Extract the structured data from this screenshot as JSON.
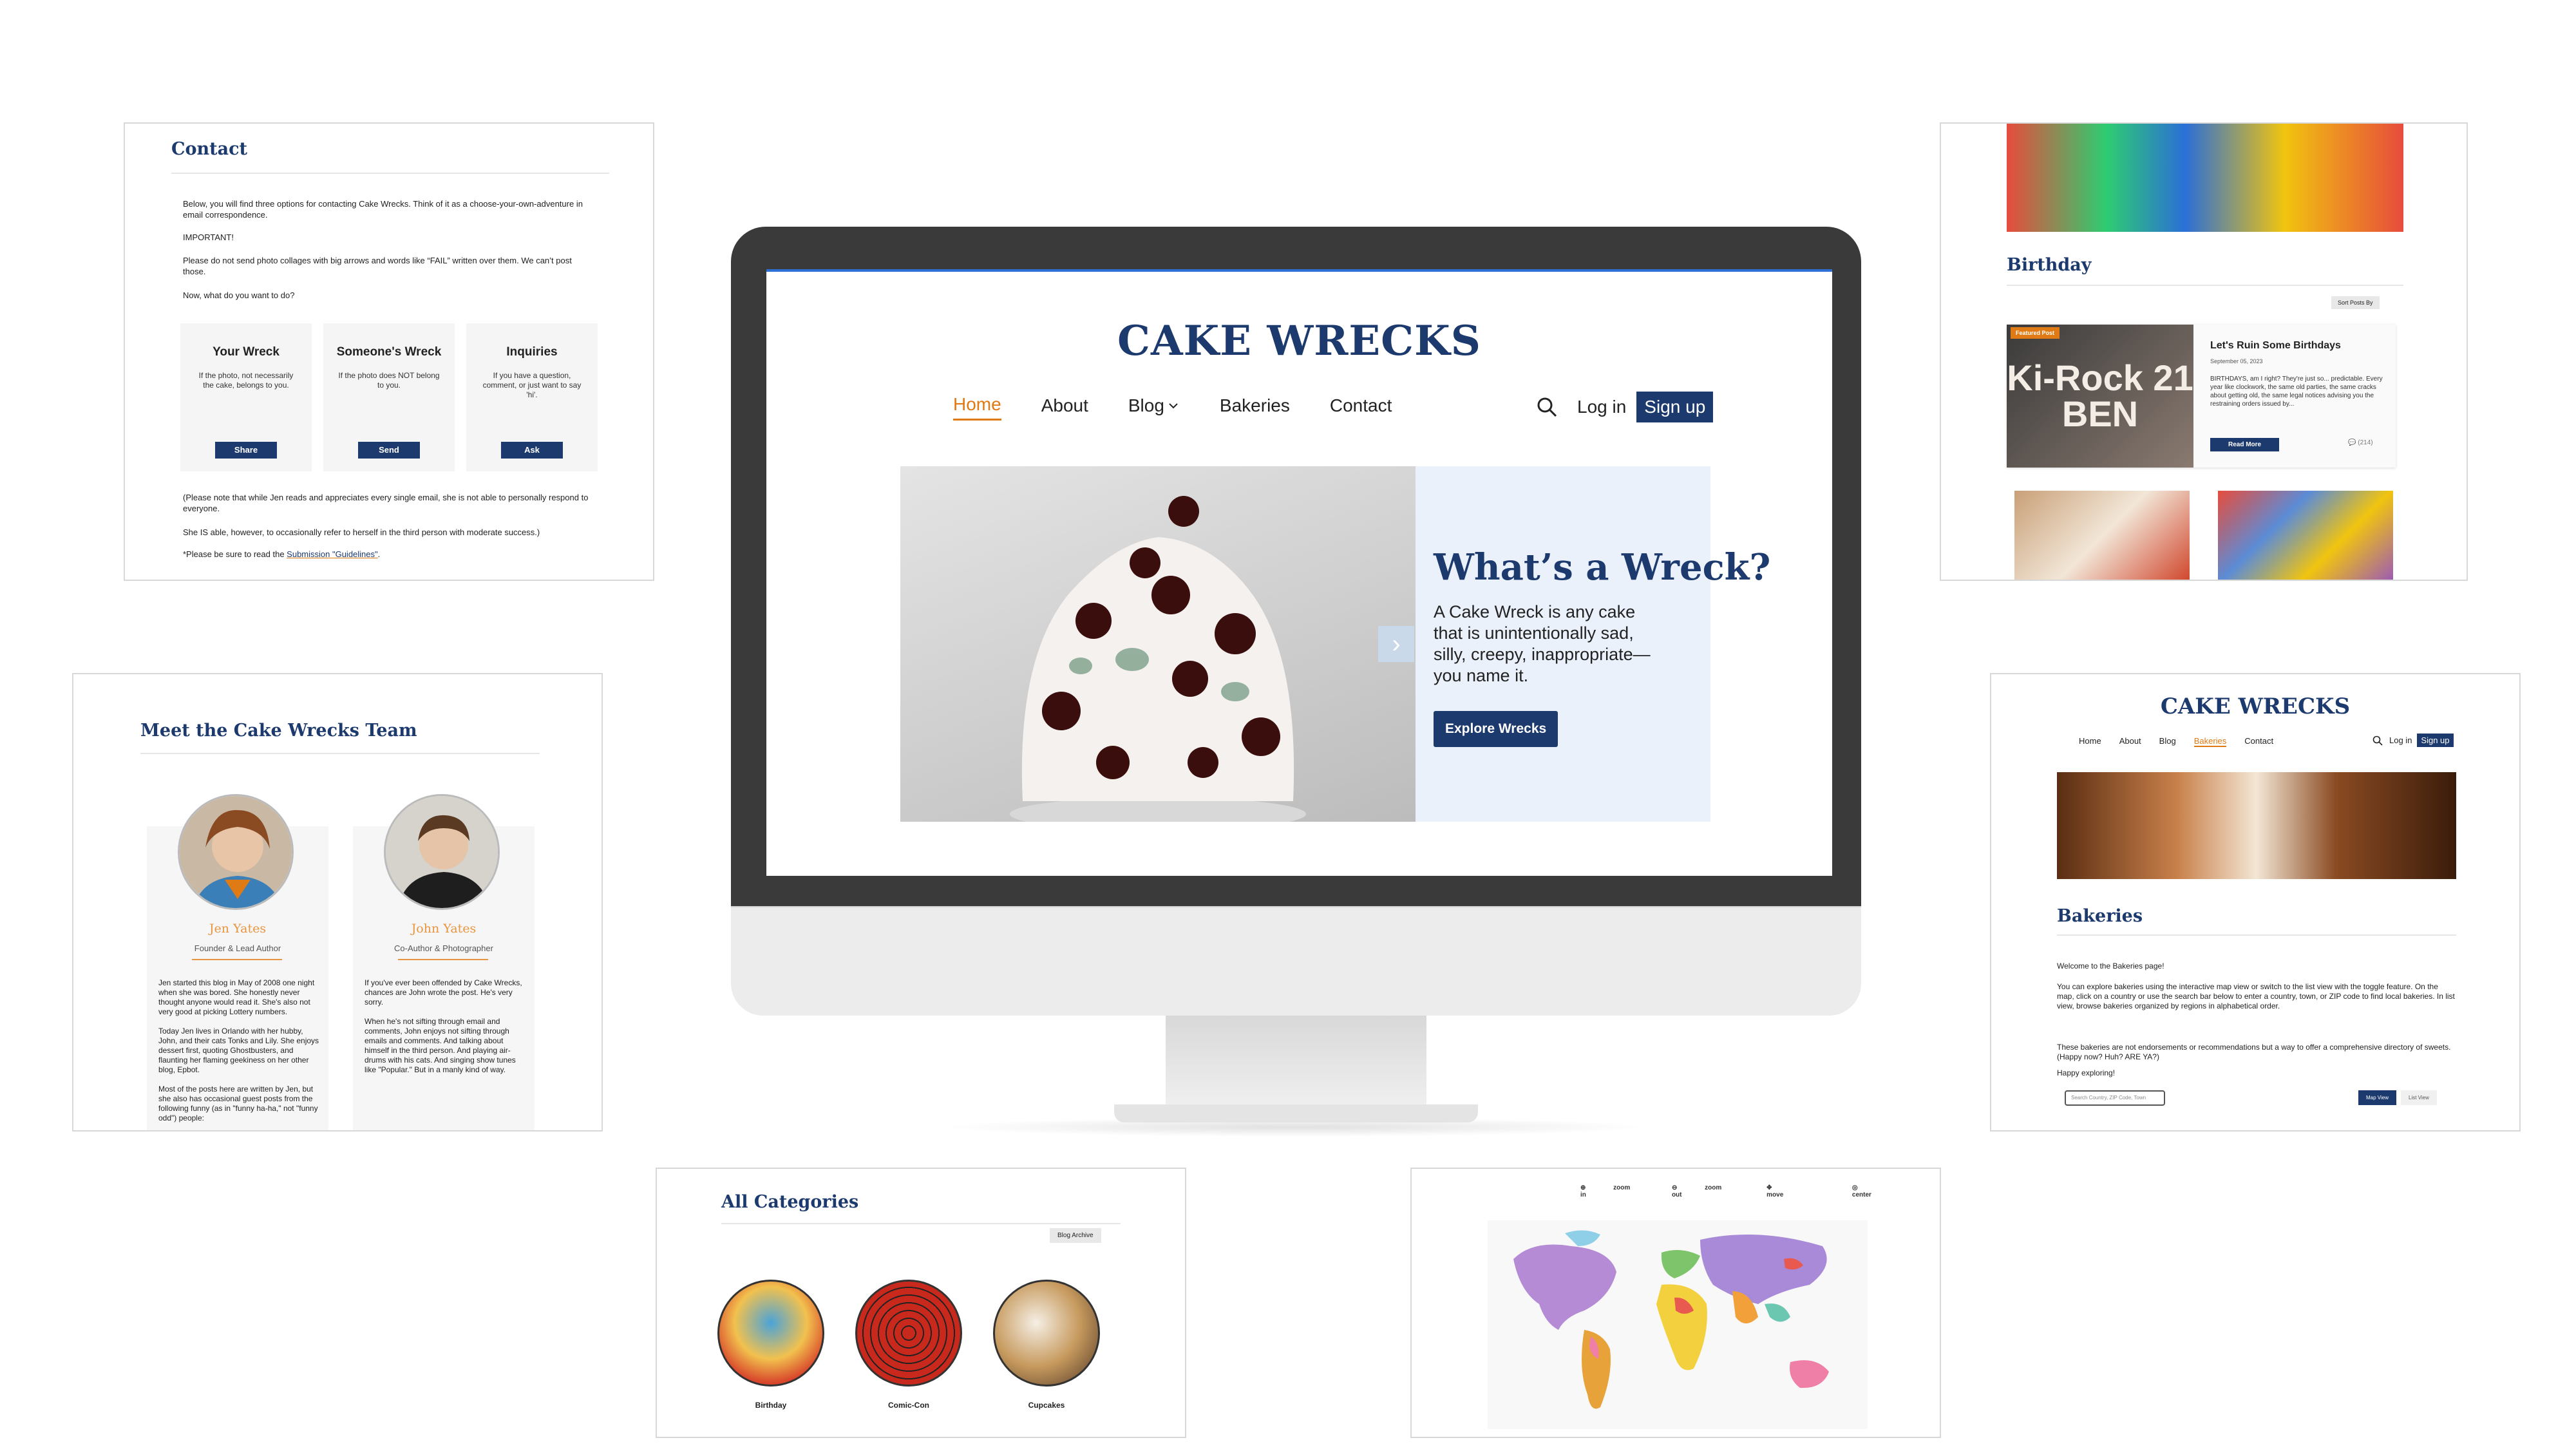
{
  "monitor": {
    "site_title": "CAKE WRECKS",
    "nav": [
      "Home",
      "About",
      "Blog",
      "Bakeries",
      "Contact"
    ],
    "login": "Log in",
    "signup": "Sign up",
    "hero": {
      "title": "What’s a Wreck?",
      "text": "A Cake Wreck is any cake that is unintentionally sad, silly, creepy, inappropriate—you name it.",
      "button": "Explore Wrecks"
    }
  },
  "contact": {
    "heading": "Contact",
    "intro": "Below, you will find three options for contacting Cake Wrecks. Think of it as a choose-your-own-adventure in email correspondence.",
    "important": "IMPORTANT!",
    "warning": "Please do not send photo collages with big arrows and words like “FAIL” written over them. We can’t post those.",
    "question": "Now, what do you want to do?",
    "options": [
      {
        "title": "Your Wreck",
        "desc": "If the photo, not necessarily the cake, belongs to you.",
        "button": "Share"
      },
      {
        "title": "Someone's Wreck",
        "desc": "If the photo does NOT belong to you.",
        "button": "Send"
      },
      {
        "title": "Inquiries",
        "desc": "If you have a question, comment, or just want to say 'hi'.",
        "button": "Ask"
      }
    ],
    "note1": "(Please note that while Jen reads and appreciates every single email, she is not able to personally respond to everyone.",
    "note2": "She IS able, however, to occasionally refer to herself in the third person with moderate success.)",
    "note3_prefix": "*Please be sure to read the ",
    "note3_link": "Submission \"Guidelines\"",
    "note3_suffix": "."
  },
  "team": {
    "heading": "Meet the Cake Wrecks Team",
    "members": [
      {
        "name": "Jen Yates",
        "role": "Founder & Lead Author",
        "bio": "Jen started this blog in May of 2008 one night when she was bored. She honestly never thought anyone would read it. She's also not very good at picking Lottery numbers.\n\nToday Jen lives in Orlando with her hubby, John, and their cats Tonks and Lily. She enjoys dessert first, quoting Ghostbusters, and flaunting her flaming geekiness on her other blog, Epbot.\n\nMost of the posts here are written by Jen, but she also has occasional guest posts from the following funny (as in \"funny ha-ha,\" not \"funny odd\") people:"
      },
      {
        "name": "John Yates",
        "role": "Co-Author & Photographer",
        "bio": "If you've ever been offended by Cake Wrecks, chances are John wrote the post. He's very sorry.\n\nWhen he's not sifting through email and comments, John enjoys not sifting through emails and comments. And talking about himself in the third person. And playing air-drums with his cats. And singing show tunes like \"Popular.\" But in a manly kind of way."
      }
    ]
  },
  "birthday": {
    "heading": "Birthday",
    "sort": "Sort Posts By",
    "featured_badge": "Featured Post",
    "cake_text": "Ki-Rock 21 BEN",
    "post_title": "Let's Ruin Some Birthdays",
    "post_date": "September 05, 2023",
    "post_excerpt": "BIRTHDAYS, am I right? They're just so... predictable. Every year like clockwork, the same old parties, the same cracks about getting old, the same legal notices advising you the restraining orders issued by...",
    "read_more": "Read More",
    "comments": "(214)"
  },
  "bakeries": {
    "site_title": "CAKE WRECKS",
    "nav": [
      "Home",
      "About",
      "Blog",
      "Bakeries",
      "Contact"
    ],
    "login": "Log in",
    "signup": "Sign up",
    "heading": "Bakeries",
    "p1": "Welcome to the Bakeries page!",
    "p2": "You can explore bakeries using the interactive map view or switch to the list view with the toggle feature. On the map, click on a country or use the search bar below to enter a country, town, or ZIP code to find local bakeries. In list view, browse bakeries organized by regions in alphabetical order.",
    "p3": "These bakeries are not endorsements or recommendations but a way to offer a comprehensive directory of sweets. (Happy now? Huh? ARE YA?)",
    "p4": "Happy exploring!",
    "search_placeholder": "Search Country, ZIP Code, Town",
    "map_view": "Map View",
    "list_view": "List View"
  },
  "categories": {
    "heading": "All Categories",
    "archive": "Blog Archive",
    "items": [
      "Birthday",
      "Comic-Con",
      "Cupcakes"
    ]
  },
  "map": {
    "controls": [
      "zoom in",
      "zoom out",
      "move",
      "center"
    ]
  }
}
